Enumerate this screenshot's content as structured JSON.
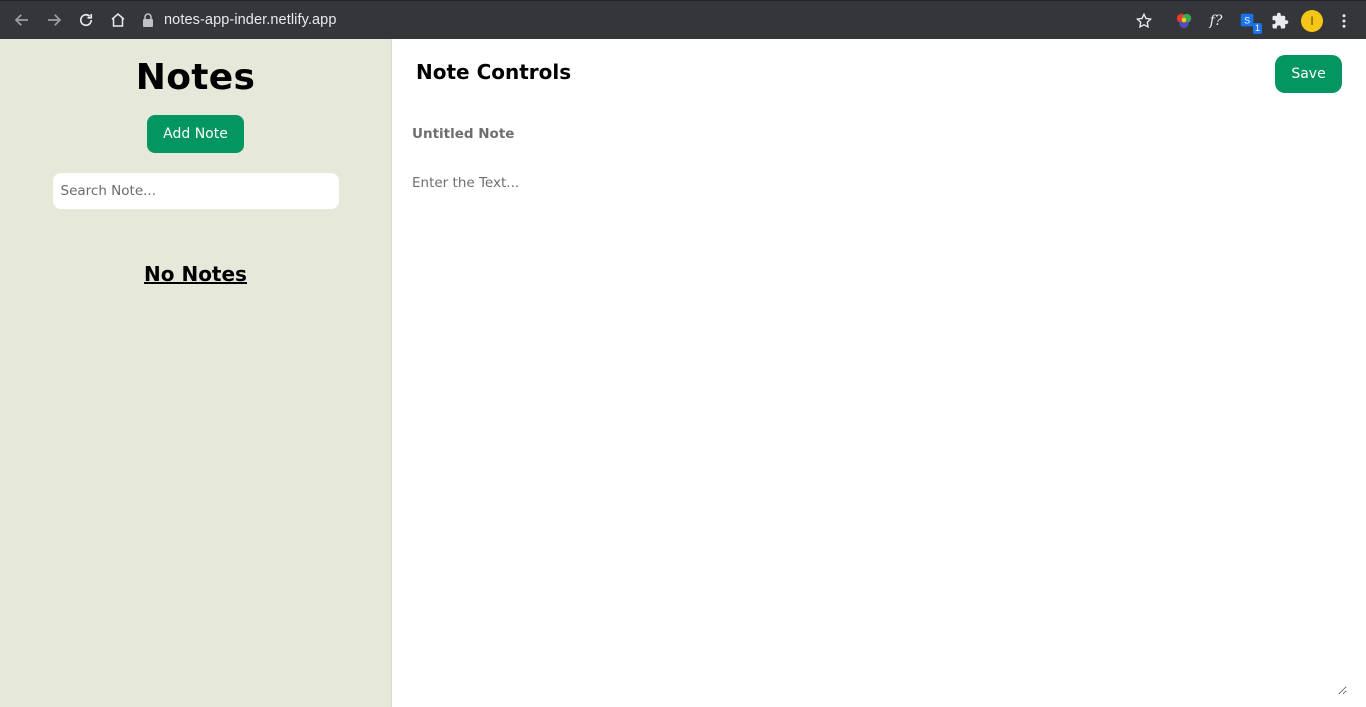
{
  "browser": {
    "url": "notes-app-inder.netlify.app",
    "avatar_initial": "I",
    "ext_formula_label": "f?",
    "ext_badge_count": "1",
    "icons": [
      "back-arrow-icon",
      "forward-arrow-icon",
      "reload-icon",
      "home-icon",
      "lock-icon",
      "star-icon",
      "color-wheel-extension-icon",
      "formula-extension-icon",
      "translate-extension-icon",
      "puzzle-extensions-icon",
      "avatar",
      "kebab-menu-icon"
    ]
  },
  "sidebar": {
    "title": "Notes",
    "add_button_label": "Add Note",
    "search_placeholder": "Search Note...",
    "search_value": "",
    "empty_message": "No Notes"
  },
  "editor": {
    "header": "Note Controls",
    "save_label": "Save",
    "title_placeholder": "Untitled Note",
    "text_placeholder": "Enter the Text..."
  },
  "colors": {
    "sidebar_bg": "#e6e8da",
    "accent_green": "#039660",
    "browser_bar": "#35363a"
  }
}
